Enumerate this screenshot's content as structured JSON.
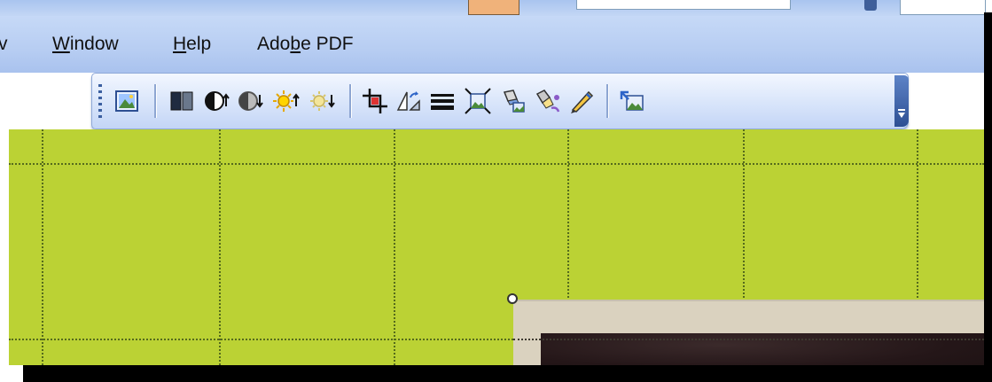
{
  "menubar": {
    "items": [
      {
        "label": "v"
      },
      {
        "label": "Window",
        "accel": "W"
      },
      {
        "label": "Help",
        "accel": "H"
      },
      {
        "label": "Adobe PDF",
        "accel": "b"
      }
    ]
  },
  "picture_toolbar": {
    "tools": [
      {
        "name": "insert-picture-icon"
      },
      {
        "name": "color-icon"
      },
      {
        "name": "more-contrast-icon"
      },
      {
        "name": "less-contrast-icon"
      },
      {
        "name": "more-brightness-icon"
      },
      {
        "name": "less-brightness-icon"
      },
      {
        "name": "crop-icon"
      },
      {
        "name": "rotate-left-icon"
      },
      {
        "name": "line-style-icon"
      },
      {
        "name": "compress-pictures-icon"
      },
      {
        "name": "format-picture-icon"
      },
      {
        "name": "set-transparent-color-icon"
      },
      {
        "name": "recolor-picture-icon"
      },
      {
        "name": "reset-picture-icon"
      }
    ]
  },
  "colors": {
    "canvas": "#bbd234",
    "menubar": "#b7cdf2",
    "photo_frame": "#dad2bf",
    "photo": "#2a1b1c"
  }
}
